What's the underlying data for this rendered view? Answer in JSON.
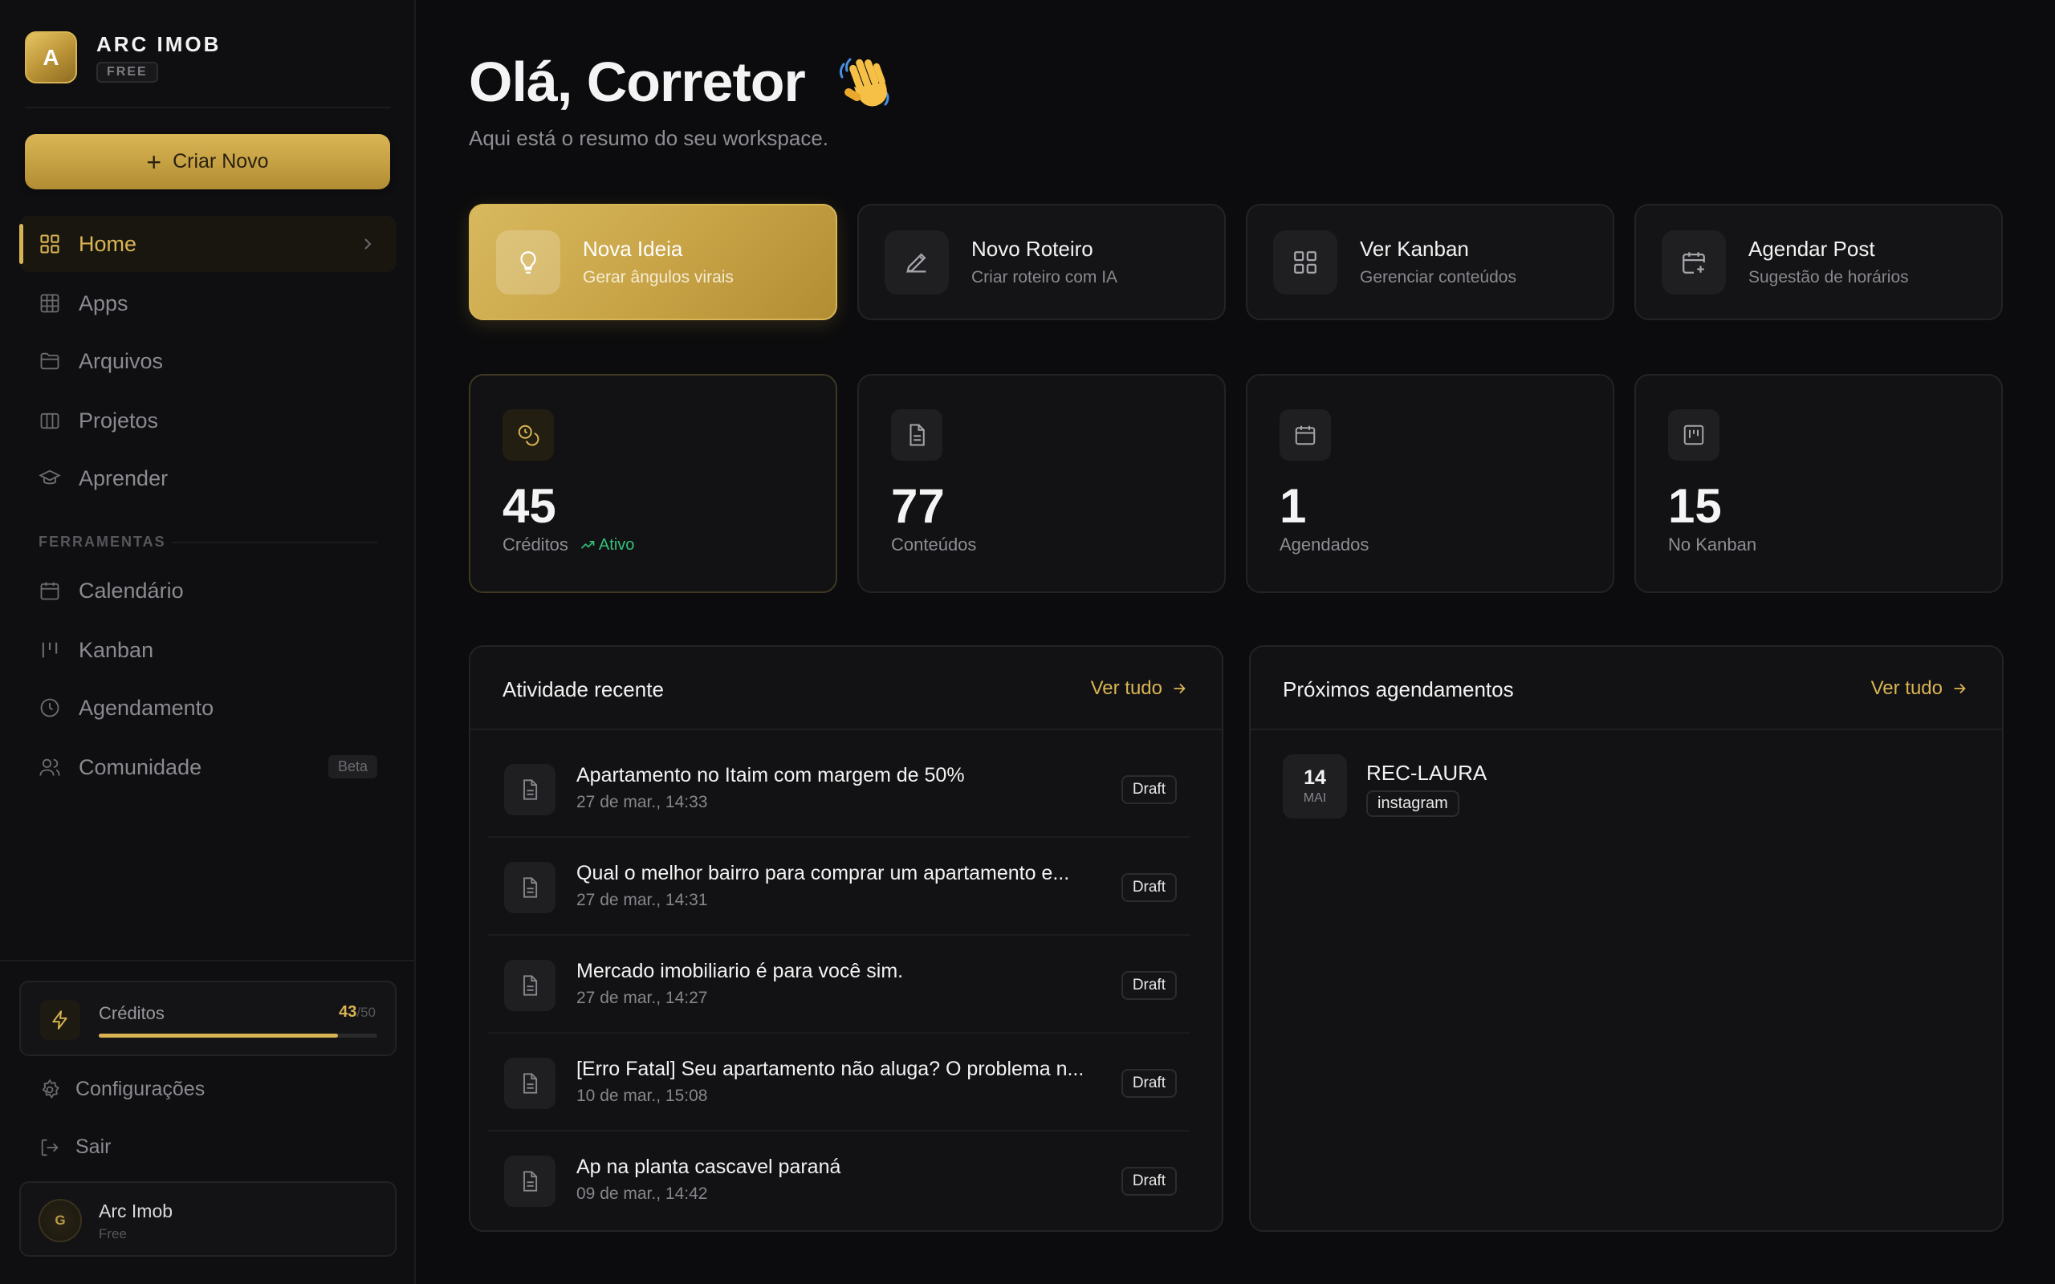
{
  "brand": {
    "initial": "A",
    "name": "ARC IMOB",
    "plan": "FREE"
  },
  "create_button": {
    "label": "Criar Novo"
  },
  "nav": {
    "items": [
      {
        "label": "Home",
        "icon": "grid-icon",
        "active": true
      },
      {
        "label": "Apps",
        "icon": "apps-grid-icon"
      },
      {
        "label": "Arquivos",
        "icon": "folder-icon"
      },
      {
        "label": "Projetos",
        "icon": "briefcase-icon"
      },
      {
        "label": "Aprender",
        "icon": "graduation-cap-icon"
      }
    ],
    "section_label": "FERRAMENTAS",
    "tools": [
      {
        "label": "Calendário",
        "icon": "calendar-icon"
      },
      {
        "label": "Kanban",
        "icon": "kanban-icon"
      },
      {
        "label": "Agendamento",
        "icon": "clock-icon"
      },
      {
        "label": "Comunidade",
        "icon": "users-icon",
        "badge": "Beta"
      }
    ]
  },
  "credits": {
    "label": "Créditos",
    "current": "43",
    "max": "/50",
    "fraction": 0.86
  },
  "bottom_links": {
    "settings": "Configurações",
    "logout": "Sair"
  },
  "user": {
    "initial": "G",
    "name": "Arc Imob",
    "plan": "Free"
  },
  "greeting": {
    "title": "Olá, Corretor",
    "emoji": "waving-hand",
    "subtitle": "Aqui está o resumo do seu workspace."
  },
  "actions": [
    {
      "title": "Nova Ideia",
      "subtitle": "Gerar ângulos virais",
      "icon": "lightbulb-icon"
    },
    {
      "title": "Novo Roteiro",
      "subtitle": "Criar roteiro com IA",
      "icon": "pencil-icon"
    },
    {
      "title": "Ver Kanban",
      "subtitle": "Gerenciar conteúdos",
      "icon": "grid-icon"
    },
    {
      "title": "Agendar Post",
      "subtitle": "Sugestão de horários",
      "icon": "calendar-plus-icon"
    }
  ],
  "stats": [
    {
      "value": "45",
      "label": "Créditos",
      "trend": "Ativo",
      "icon": "coins-icon"
    },
    {
      "value": "77",
      "label": "Conteúdos",
      "icon": "document-icon"
    },
    {
      "value": "1",
      "label": "Agendados",
      "icon": "calendar-icon"
    },
    {
      "value": "15",
      "label": "No Kanban",
      "icon": "kanban-icon"
    }
  ],
  "activity": {
    "title": "Atividade recente",
    "link": "Ver tudo",
    "items": [
      {
        "title": "Apartamento no Itaim com margem de 50%",
        "date": "27 de mar., 14:33",
        "status": "Draft"
      },
      {
        "title": "Qual o melhor bairro para comprar um apartamento e...",
        "date": "27 de mar., 14:31",
        "status": "Draft"
      },
      {
        "title": "Mercado imobiliario é para você sim.",
        "date": "27 de mar., 14:27",
        "status": "Draft"
      },
      {
        "title": "[Erro Fatal] Seu apartamento não aluga? O problema n...",
        "date": "10 de mar., 15:08",
        "status": "Draft"
      },
      {
        "title": "Ap na planta cascavel paraná",
        "date": "09 de mar., 14:42",
        "status": "Draft"
      }
    ]
  },
  "schedule": {
    "title": "Próximos agendamentos",
    "link": "Ver tudo",
    "items": [
      {
        "day": "14",
        "month": "MAI",
        "title": "REC-LAURA",
        "platform": "instagram"
      }
    ]
  },
  "colors": {
    "accent": "#d9b453",
    "background": "#0c0c0e",
    "card": "#141416",
    "success": "#35c07a"
  }
}
